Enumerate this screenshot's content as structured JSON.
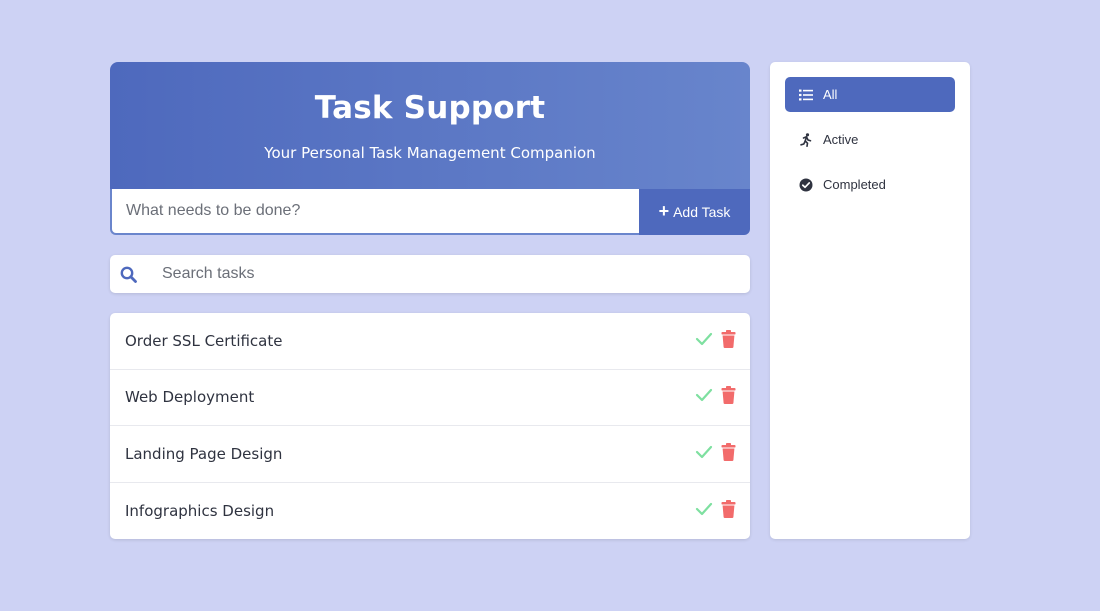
{
  "header": {
    "title": "Task Support",
    "subtitle": "Your Personal Task Management Companion"
  },
  "add_task": {
    "placeholder": "What needs to be done?",
    "button_label": "Add Task",
    "button_icon": "plus-icon"
  },
  "search": {
    "placeholder": "Search tasks",
    "icon": "search-icon"
  },
  "tasks": [
    {
      "title": "Order SSL Certificate"
    },
    {
      "title": "Web Deployment"
    },
    {
      "title": "Landing Page Design"
    },
    {
      "title": "Infographics Design"
    }
  ],
  "task_actions": {
    "complete_icon": "check-icon",
    "delete_icon": "trash-icon"
  },
  "filters": [
    {
      "label": "All",
      "icon": "list-icon",
      "active": true
    },
    {
      "label": "Active",
      "icon": "running-icon",
      "active": false
    },
    {
      "label": "Completed",
      "icon": "check-circle-icon",
      "active": false
    }
  ],
  "colors": {
    "background": "#cdd2f4",
    "primary": "#4e69bd",
    "complete": "#7ee0a0",
    "delete": "#f26b6b"
  }
}
